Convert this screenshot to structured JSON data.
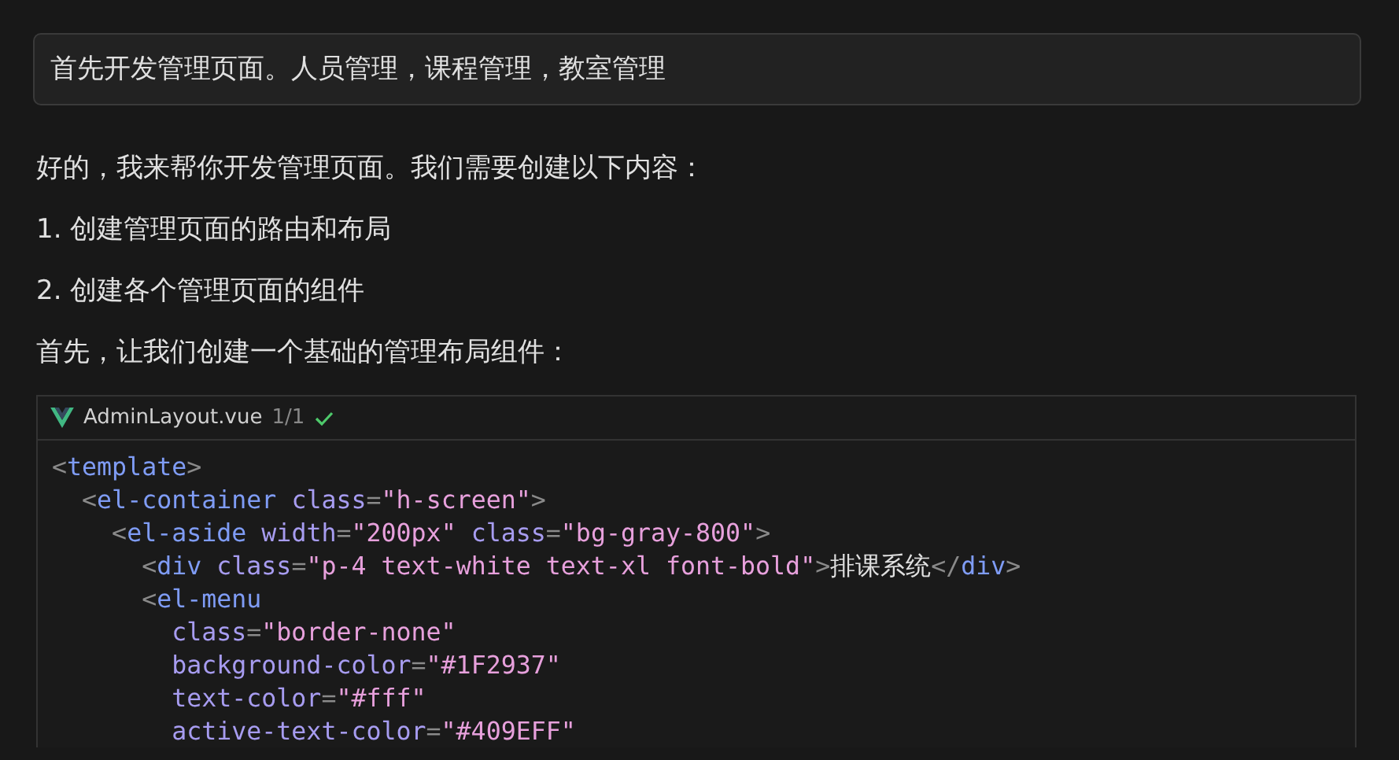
{
  "user_message": "首先开发管理页面。人员管理，课程管理，教室管理",
  "response": {
    "paragraphs": [
      "好的，我来帮你开发管理页面。我们需要创建以下内容：",
      "1. 创建管理页面的路由和布局",
      "2. 创建各个管理页面的组件",
      "首先，让我们创建一个基础的管理布局组件："
    ]
  },
  "code_block": {
    "filename": "AdminLayout.vue",
    "counter": "1/1",
    "applied": true,
    "lines": [
      [
        {
          "kind": "punct",
          "text": "<"
        },
        {
          "kind": "tag",
          "text": "template"
        },
        {
          "kind": "punct",
          "text": ">"
        }
      ],
      [
        {
          "kind": "punct",
          "text": "  <"
        },
        {
          "kind": "tag",
          "text": "el-container"
        },
        {
          "kind": "attr",
          "text": " class"
        },
        {
          "kind": "punct",
          "text": "="
        },
        {
          "kind": "string",
          "text": "\"h-screen\""
        },
        {
          "kind": "punct",
          "text": ">"
        }
      ],
      [
        {
          "kind": "punct",
          "text": "    <"
        },
        {
          "kind": "tag",
          "text": "el-aside"
        },
        {
          "kind": "attr",
          "text": " width"
        },
        {
          "kind": "punct",
          "text": "="
        },
        {
          "kind": "string",
          "text": "\"200px\""
        },
        {
          "kind": "attr",
          "text": " class"
        },
        {
          "kind": "punct",
          "text": "="
        },
        {
          "kind": "string",
          "text": "\"bg-gray-800\""
        },
        {
          "kind": "punct",
          "text": ">"
        }
      ],
      [
        {
          "kind": "punct",
          "text": "      <"
        },
        {
          "kind": "tag",
          "text": "div"
        },
        {
          "kind": "attr",
          "text": " class"
        },
        {
          "kind": "punct",
          "text": "="
        },
        {
          "kind": "string",
          "text": "\"p-4 text-white text-xl font-bold\""
        },
        {
          "kind": "punct",
          "text": ">"
        },
        {
          "kind": "text",
          "text": "排课系统"
        },
        {
          "kind": "punct",
          "text": "</"
        },
        {
          "kind": "tag",
          "text": "div"
        },
        {
          "kind": "punct",
          "text": ">"
        }
      ],
      [
        {
          "kind": "punct",
          "text": "      <"
        },
        {
          "kind": "tag",
          "text": "el-menu"
        }
      ],
      [
        {
          "kind": "attr",
          "text": "        class"
        },
        {
          "kind": "punct",
          "text": "="
        },
        {
          "kind": "string",
          "text": "\"border-none\""
        }
      ],
      [
        {
          "kind": "attr",
          "text": "        background-color"
        },
        {
          "kind": "punct",
          "text": "="
        },
        {
          "kind": "string",
          "text": "\"#1F2937\""
        }
      ],
      [
        {
          "kind": "attr",
          "text": "        text-color"
        },
        {
          "kind": "punct",
          "text": "="
        },
        {
          "kind": "string",
          "text": "\"#fff\""
        }
      ],
      [
        {
          "kind": "attr",
          "text": "        active-text-color"
        },
        {
          "kind": "punct",
          "text": "="
        },
        {
          "kind": "string",
          "text": "\"#409EFF\""
        }
      ]
    ]
  }
}
